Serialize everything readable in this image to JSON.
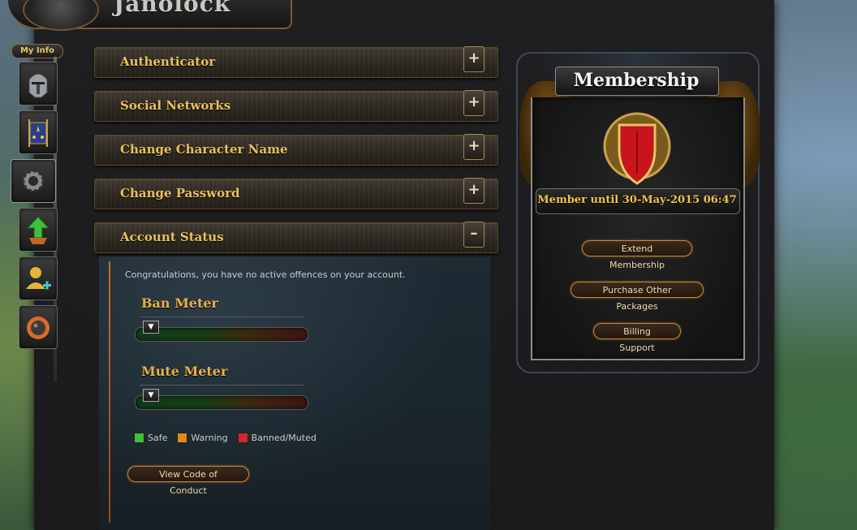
{
  "header": {
    "logo_text": "Janolock"
  },
  "nav": {
    "my_info_label": "My Info",
    "items": [
      {
        "name": "helmet",
        "icon": "⛑"
      },
      {
        "name": "banner",
        "icon": "⚑"
      },
      {
        "name": "gear",
        "icon": "⚙"
      },
      {
        "name": "upgrade",
        "icon": "⬆"
      },
      {
        "name": "add-user",
        "icon": "+"
      },
      {
        "name": "bomb",
        "icon": "✹"
      }
    ]
  },
  "accordion": {
    "authenticator": {
      "label": "Authenticator",
      "toggle": "+"
    },
    "social": {
      "label": "Social Networks",
      "toggle": "+"
    },
    "change_name": {
      "label": "Change Character Name",
      "toggle": "+"
    },
    "change_password": {
      "label": "Change Password",
      "toggle": "+"
    },
    "account_status": {
      "label": "Account Status",
      "toggle": "–"
    }
  },
  "status": {
    "message": "Congratulations, you have no active offences on your account.",
    "ban_meter": {
      "title": "Ban Meter",
      "level": 0
    },
    "mute_meter": {
      "title": "Mute Meter",
      "level": 0
    },
    "legend": {
      "safe": {
        "label": "Safe",
        "color": "#3fbf3a"
      },
      "warning": {
        "label": "Warning",
        "color": "#e0891c"
      },
      "banned": {
        "label": "Banned/Muted",
        "color": "#d8262c"
      }
    },
    "code_of_conduct_button": "View Code of Conduct"
  },
  "membership": {
    "title": "Membership",
    "member_until": "Member until 30-May-2015 06:47",
    "buttons": {
      "extend": "Extend Membership",
      "purchase": "Purchase Other Packages",
      "billing": "Billing Support"
    }
  }
}
